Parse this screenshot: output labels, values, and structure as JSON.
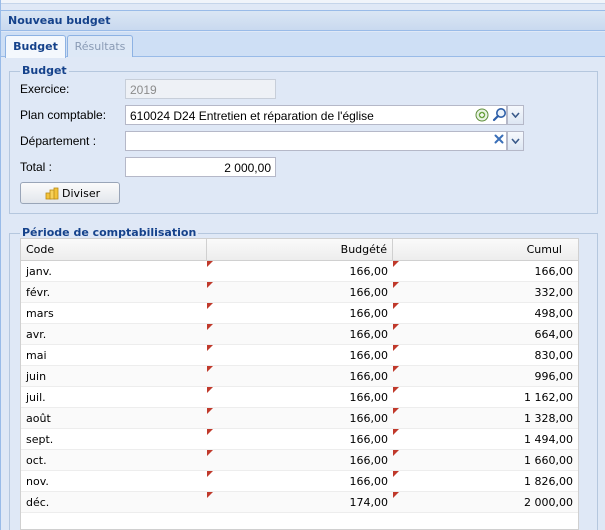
{
  "window": {
    "title": "Nouveau budget"
  },
  "tabs": [
    {
      "label": "Budget",
      "active": true
    },
    {
      "label": "Résultats",
      "active": false
    }
  ],
  "budget_section": {
    "legend": "Budget",
    "exercice_label": "Exercice:",
    "exercice_value": "2019",
    "plan_label": "Plan comptable:",
    "plan_value": "610024 D24 Entretien et réparation de l'église",
    "departement_label": "Département :",
    "departement_value": "",
    "total_label": "Total :",
    "total_value": "2 000,00",
    "diviser_label": "Diviser"
  },
  "periode_section": {
    "legend": "Période de comptabilisation",
    "columns": [
      "Code",
      "Budgété",
      "Cumul"
    ],
    "rows": [
      {
        "code": "janv.",
        "budgete": "166,00",
        "cumul": "166,00"
      },
      {
        "code": "févr.",
        "budgete": "166,00",
        "cumul": "332,00"
      },
      {
        "code": "mars",
        "budgete": "166,00",
        "cumul": "498,00"
      },
      {
        "code": "avr.",
        "budgete": "166,00",
        "cumul": "664,00"
      },
      {
        "code": "mai",
        "budgete": "166,00",
        "cumul": "830,00"
      },
      {
        "code": "juin",
        "budgete": "166,00",
        "cumul": "996,00"
      },
      {
        "code": "juil.",
        "budgete": "166,00",
        "cumul": "1 162,00"
      },
      {
        "code": "août",
        "budgete": "166,00",
        "cumul": "1 328,00"
      },
      {
        "code": "sept.",
        "budgete": "166,00",
        "cumul": "1 494,00"
      },
      {
        "code": "oct.",
        "budgete": "166,00",
        "cumul": "1 660,00"
      },
      {
        "code": "nov.",
        "budgete": "166,00",
        "cumul": "1 826,00"
      },
      {
        "code": "déc.",
        "budgete": "174,00",
        "cumul": "2 000,00"
      }
    ]
  },
  "icons": {
    "add": "plus-circle-icon",
    "search": "magnifier-icon",
    "dropdown": "chevron-down-icon",
    "clear": "close-icon",
    "coins": "coins-icon",
    "dirty": "dirty-cell-flag-icon"
  },
  "colors": {
    "accent": "#15428b",
    "panel": "#dfe8f6",
    "border": "#99bbe8",
    "dirty_flag": "#c0392b"
  }
}
